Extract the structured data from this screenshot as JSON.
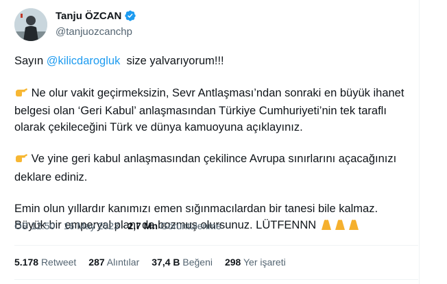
{
  "author": {
    "display_name": "Tanju ÖZCAN",
    "handle": "@tanjuozcanchp"
  },
  "tweet": {
    "line1_prefix": "Sayın ",
    "mention": "@kilicdarogluk",
    "line1_suffix": "  size yalvarıyorum!!!",
    "para2": "Ne olur vakit geçirmeksizin, Sevr Antlaşması’ndan sonraki en büyük ihanet belgesi olan ‘Geri Kabul’ anlaşmasından Türkiye Cumhuriyeti’nin tek taraflı olarak çekileceğini Türk ve dünya kamuoyuna açıklayınız.",
    "para3": "Ve yine geri kabul anlaşmasından çekilince Avrupa sınırlarını açacağınızı deklare ediniz.",
    "para4": "Emin olun yıllardır kanımızı emen sığınmacılardan bir tanesi bile kalmaz. Büyük bir emperyal planı da bozmuş olursunuz. LÜTFENNN"
  },
  "meta": {
    "time": "ÖS 12:50",
    "dot": "·",
    "date": "16 May 2023",
    "views_count": "2,7 Mn",
    "views_label": "Görüntülenme"
  },
  "stats": {
    "retweets_count": "5.178",
    "retweets_label": "Retweet",
    "quotes_count": "287",
    "quotes_label": "Alıntılar",
    "likes_count": "37,4 B",
    "likes_label": "Beğeni",
    "bookmarks_count": "298",
    "bookmarks_label": "Yer işareti"
  },
  "colors": {
    "accent": "#1d9bf0",
    "secondary_text": "#536471",
    "primary_text": "#0f1419"
  }
}
